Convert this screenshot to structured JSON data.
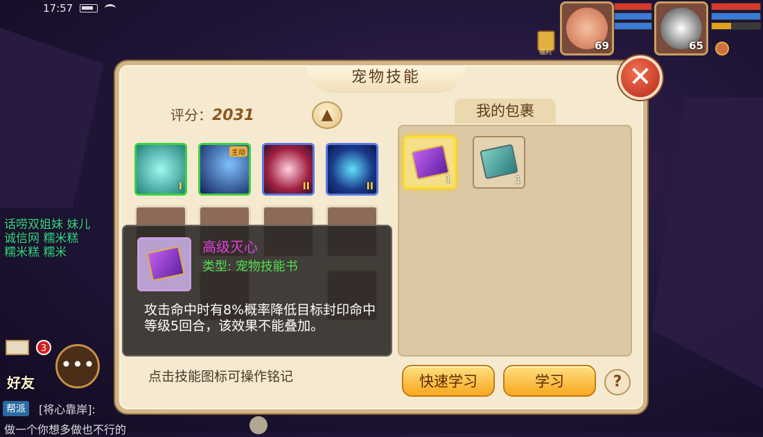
{
  "status": {
    "time": "17:57"
  },
  "hud": {
    "pet1_level": "69",
    "pet2_level": "65",
    "gift_label": "福利"
  },
  "chat": {
    "lines": [
      "话唠双姐妹 妹儿",
      "诚信网 糯米糕",
      "糯米糕 糯米"
    ],
    "mail_badge": "3",
    "friends_label": "好友",
    "guild_tag": "帮派",
    "guild_text": "[将心靠岸]:",
    "bottom_text": "做一个你想多做也不行的"
  },
  "panel": {
    "title": "宠物技能",
    "score_label": "评分：",
    "score_value": "2031",
    "skills": [
      {
        "badge": "I",
        "tag": ""
      },
      {
        "badge": "",
        "tag": "主动"
      },
      {
        "badge": "II",
        "tag": ""
      },
      {
        "badge": "II",
        "tag": ""
      }
    ],
    "bag_title": "我的包裹",
    "bag_items": [
      {
        "name": "高级灭心",
        "qty": "1",
        "selected": true
      },
      {
        "name": "技能书",
        "qty": "1",
        "selected": false
      }
    ],
    "tooltip": {
      "name": "高级灭心",
      "type": "类型: 宠物技能书",
      "description": "攻击命中时有8%概率降低目标封印命中等级5回合，该效果不能叠加。"
    },
    "hint": "点击技能图标可操作铭记",
    "quick_learn_label": "快速学习",
    "learn_label": "学习",
    "help_label": "?"
  }
}
